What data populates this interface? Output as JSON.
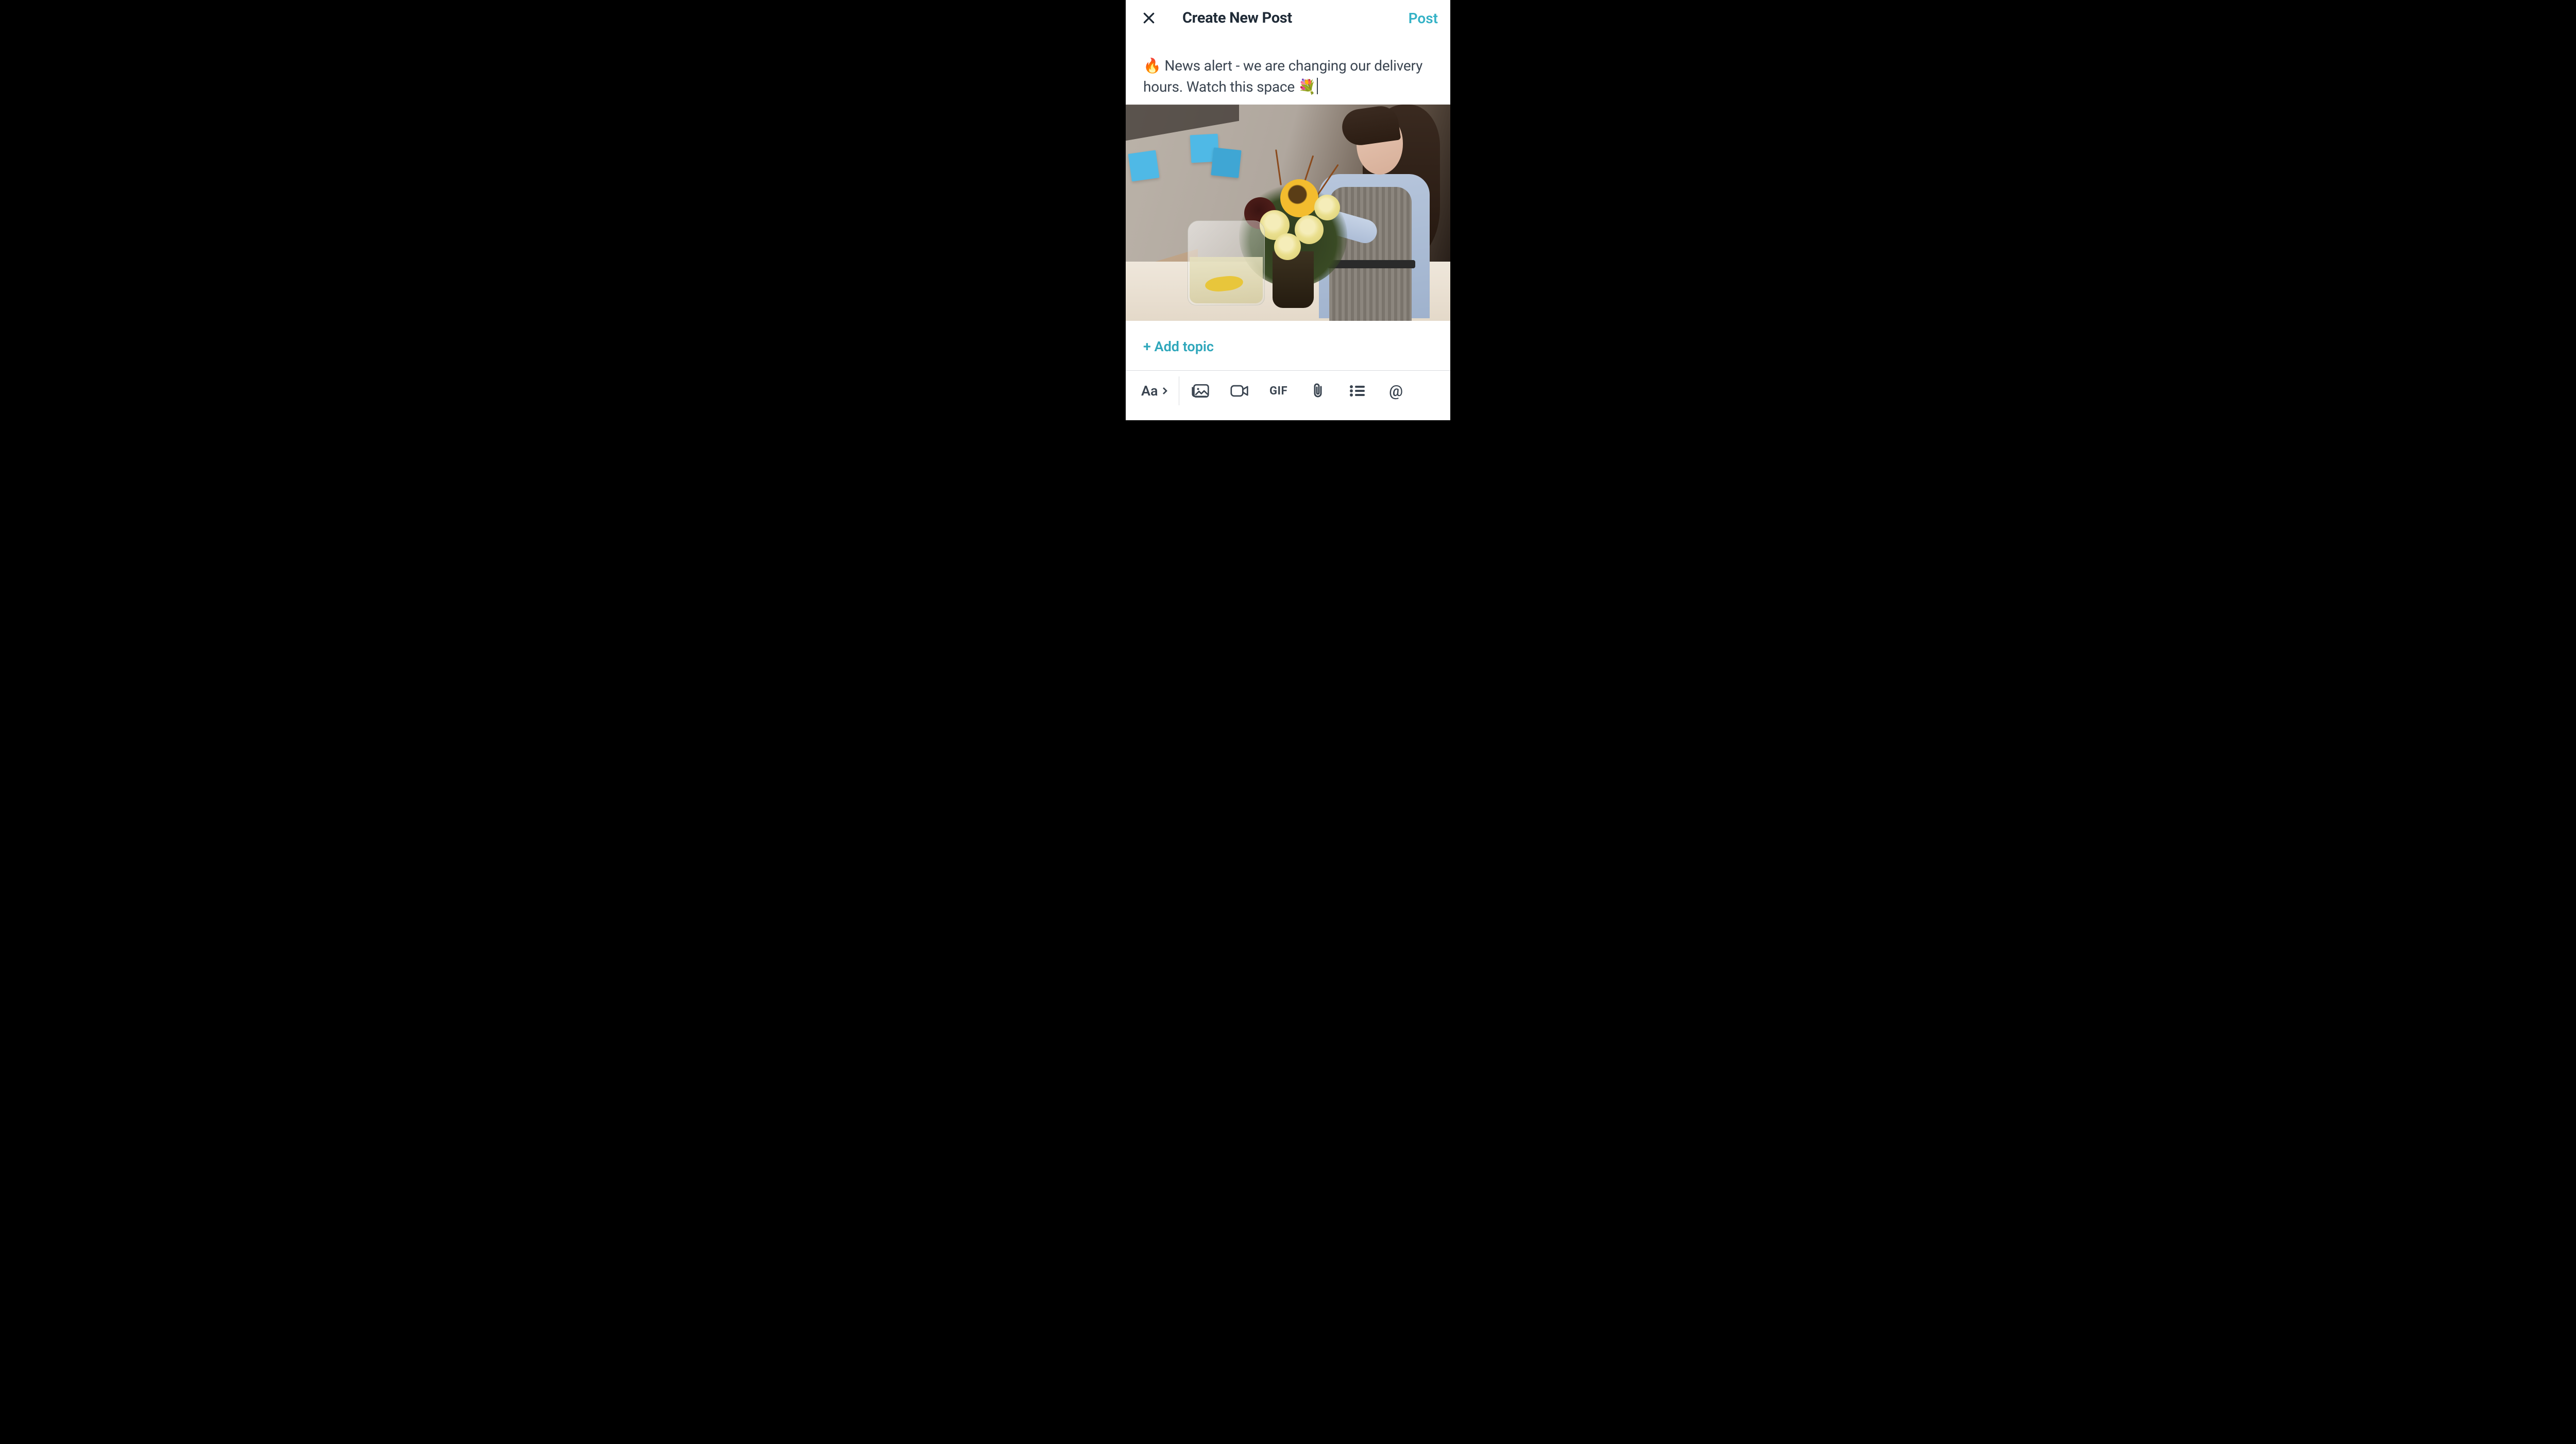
{
  "header": {
    "title": "Create New Post",
    "post_label": "Post"
  },
  "compose": {
    "text": "🔥 News alert - we are changing our delivery hours. Watch this space 💐"
  },
  "add_topic": {
    "label": "+ Add topic"
  },
  "toolbar": {
    "text_label": "Aa",
    "gif_label": "GIF",
    "mention_label": "@"
  },
  "icons": {
    "close": "close-icon",
    "text_format": "text-format-icon",
    "image": "image-icon",
    "video": "video-icon",
    "gif": "gif-icon",
    "attach": "attachment-icon",
    "list": "list-icon",
    "mention": "mention-icon"
  },
  "colors": {
    "accent": "#35B2C6",
    "text": "#3A4450",
    "heading": "#1F2A36"
  }
}
